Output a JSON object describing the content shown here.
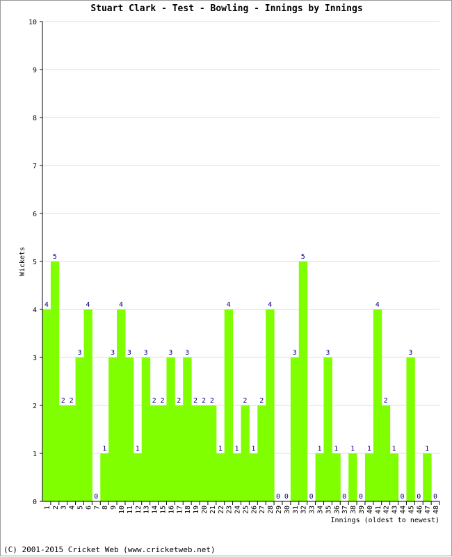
{
  "chart_data": {
    "type": "bar",
    "title": "Stuart Clark - Test - Bowling - Innings by Innings",
    "xlabel": "Innings (oldest to newest)",
    "ylabel": "Wickets",
    "ylim": [
      0,
      10
    ],
    "yticks": [
      0,
      1,
      2,
      3,
      4,
      5,
      6,
      7,
      8,
      9,
      10
    ],
    "grid": true,
    "categories": [
      "1",
      "2",
      "3",
      "4",
      "5",
      "6",
      "7",
      "8",
      "9",
      "10",
      "11",
      "12",
      "13",
      "14",
      "15",
      "16",
      "17",
      "18",
      "19",
      "20",
      "21",
      "22",
      "23",
      "24",
      "25",
      "26",
      "27",
      "28",
      "29",
      "30",
      "31",
      "32",
      "33",
      "34",
      "35",
      "36",
      "37",
      "38",
      "39",
      "40",
      "41",
      "42",
      "43",
      "44",
      "45",
      "46",
      "47",
      "48"
    ],
    "values": [
      4,
      5,
      2,
      2,
      3,
      4,
      0,
      1,
      3,
      4,
      3,
      1,
      3,
      2,
      2,
      3,
      2,
      3,
      2,
      2,
      2,
      1,
      4,
      1,
      2,
      1,
      2,
      4,
      0,
      0,
      3,
      5,
      0,
      1,
      3,
      1,
      0,
      1,
      0,
      1,
      4,
      2,
      1,
      0,
      3,
      0,
      1,
      0
    ],
    "bar_color": "#80ff00",
    "label_color": "#000080",
    "grid_color": "#dddddd"
  },
  "footer": "(C) 2001-2015 Cricket Web (www.cricketweb.net)"
}
